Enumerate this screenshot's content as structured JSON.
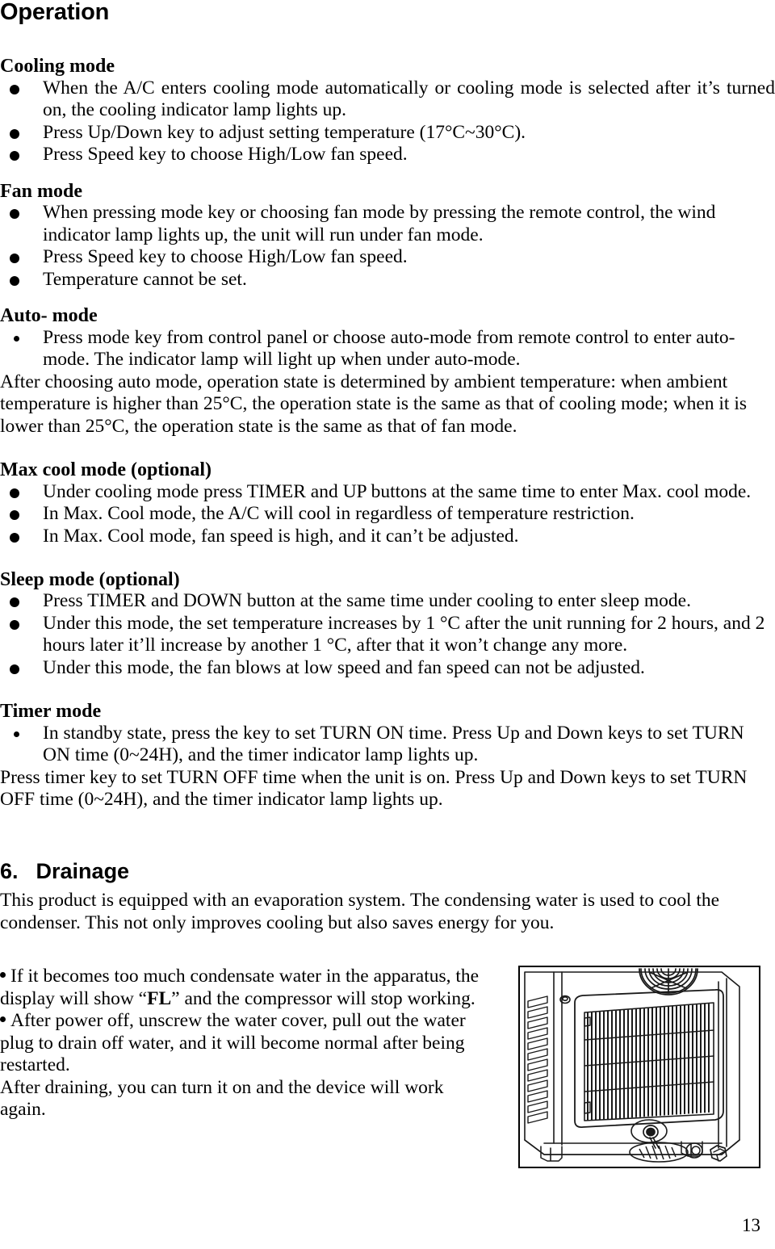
{
  "page": {
    "title": "Operation",
    "number": "13"
  },
  "sections": {
    "cooling": {
      "heading": "Cooling mode",
      "bullets": [
        "When the A/C enters cooling mode automatically or cooling mode is selected after it’s turned on, the cooling indicator lamp lights up.",
        "Press Up/Down key to adjust setting temperature (17°C~30°C).",
        "Press Speed key to choose High/Low fan speed."
      ]
    },
    "fan": {
      "heading": "Fan mode",
      "bullets": [
        "When pressing mode key or choosing fan mode by pressing the remote control, the wind indicator lamp lights up, the unit will run under fan mode.",
        "Press Speed key to choose High/Low fan speed.",
        "Temperature cannot be set."
      ]
    },
    "auto": {
      "heading": "Auto- mode",
      "bullets": [
        "Press mode key from control panel or choose auto-mode from remote control to enter auto-mode. The indicator lamp will light up when under auto-mode."
      ],
      "paragraph": "After choosing auto mode, operation state is determined by ambient temperature: when ambient temperature is higher than 25°C, the operation state is the same as that of cooling mode; when it is lower than 25°C, the operation state is the same as that of fan mode."
    },
    "maxcool": {
      "heading": "Max cool mode (optional)",
      "bullets": [
        "Under cooling mode press TIMER and UP buttons at the same time to enter Max. cool mode.",
        "In Max. Cool mode, the A/C will cool in regardless of temperature restriction.",
        "In Max. Cool mode, fan speed is high, and it can’t be adjusted."
      ]
    },
    "sleep": {
      "heading": "Sleep mode (optional)",
      "bullets": [
        "Press TIMER and DOWN button at the same time under cooling to enter sleep mode.",
        "Under this mode, the set temperature increases by 1 °C after the unit running for 2 hours, and 2 hours later it’ll increase by another 1 °C, after that it won’t change any more.",
        "Under this mode, the fan blows at low speed and fan speed can not be adjusted."
      ]
    },
    "timer": {
      "heading": "Timer mode",
      "bullets": [
        "In standby state, press the key to set TURN ON time. Press Up and Down keys to set TURN ON time (0~24H), and the timer indicator lamp lights up."
      ],
      "paragraph": "Press timer key to set TURN OFF time when the unit is on. Press Up and Down keys to set TURN OFF time (0~24H), and the timer indicator lamp lights up."
    },
    "drainage": {
      "number": "6.",
      "heading": "Drainage",
      "intro": "This product is equipped with an evaporation system. The condensing water is used to cool the condenser. This not only improves cooling but also saves energy for you.",
      "note_1_before": "If it becomes too much condensate water in the apparatus, the display will show “",
      "note_1_bold": "FL",
      "note_1_after": "” and the compressor will stop working.",
      "note_2": "After power off, unscrew the water cover, pull out the water plug to drain off water, and it will become normal after being restarted.",
      "note_3": "After draining, you can turn it on and the device will work again.",
      "figure_caption": "portable-air-conditioner-rear-drain-outlet-line-drawing"
    }
  }
}
